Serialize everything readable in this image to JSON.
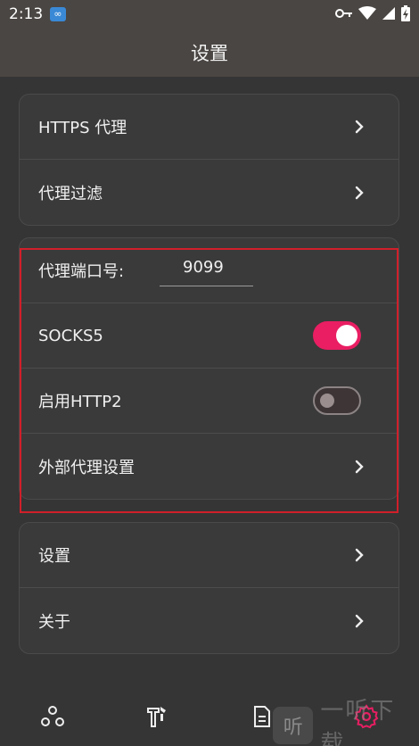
{
  "status_bar": {
    "time": "2:13",
    "app_badge": "∞"
  },
  "app_bar": {
    "title": "设置"
  },
  "group1": {
    "items": [
      {
        "label": "HTTPS 代理"
      },
      {
        "label": "代理过滤"
      }
    ]
  },
  "group2": {
    "port_label": "代理端口号:",
    "port_value": "9099",
    "socks5_label": "SOCKS5",
    "socks5_enabled": true,
    "http2_label": "启用HTTP2",
    "http2_enabled": false,
    "external_proxy_label": "外部代理设置"
  },
  "group3": {
    "items": [
      {
        "label": "设置"
      },
      {
        "label": "关于"
      }
    ]
  },
  "bottom_nav": {
    "items": [
      {
        "icon": "network-icon"
      },
      {
        "icon": "tools-icon"
      },
      {
        "icon": "document-icon"
      },
      {
        "icon": "gear-icon",
        "active": true
      }
    ],
    "active_color": "#e91e63"
  },
  "watermark": {
    "badge": "听",
    "text": "一听下载"
  },
  "colors": {
    "accent": "#e91e63",
    "highlight_box": "#d11f2a",
    "app_bar": "#4a4643",
    "background": "#353535"
  }
}
